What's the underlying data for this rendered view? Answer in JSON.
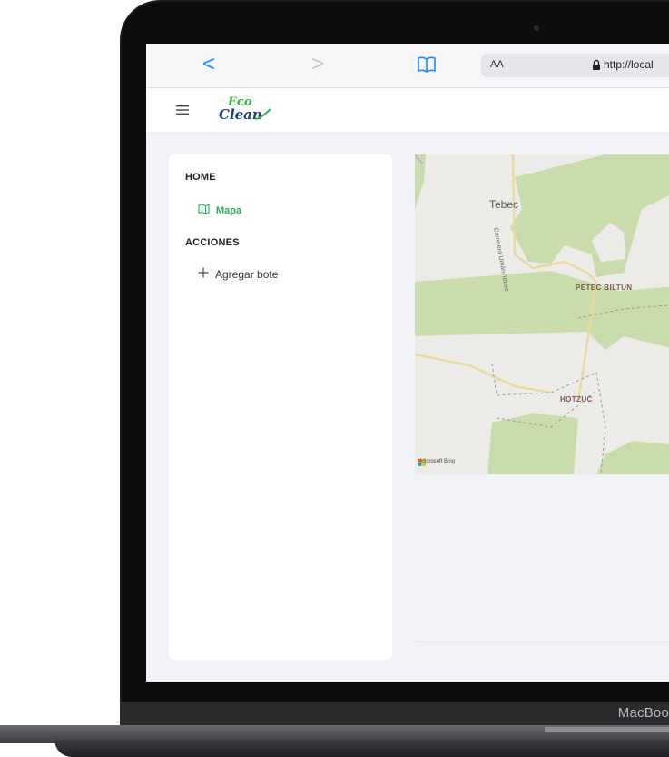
{
  "device": {
    "chin_label": "MacBoo"
  },
  "browser": {
    "back_glyph": "<",
    "forward_glyph": ">",
    "aa_label": "AA",
    "url": "http://local"
  },
  "app": {
    "logo_top": "Eco",
    "logo_bottom": "Clean"
  },
  "sidebar": {
    "home_label": "HOME",
    "mapa_label": "Mapa",
    "acciones_label": "ACCIONES",
    "agregar_label": "Agregar bote",
    "accent_color": "#2eaa5c"
  },
  "map": {
    "places": [
      "Tebec",
      "PETEC BILTUN",
      "HOTZUC"
    ],
    "road_label": "Carretera Umán-Tebec",
    "attribution": "Microsoft Bing"
  }
}
